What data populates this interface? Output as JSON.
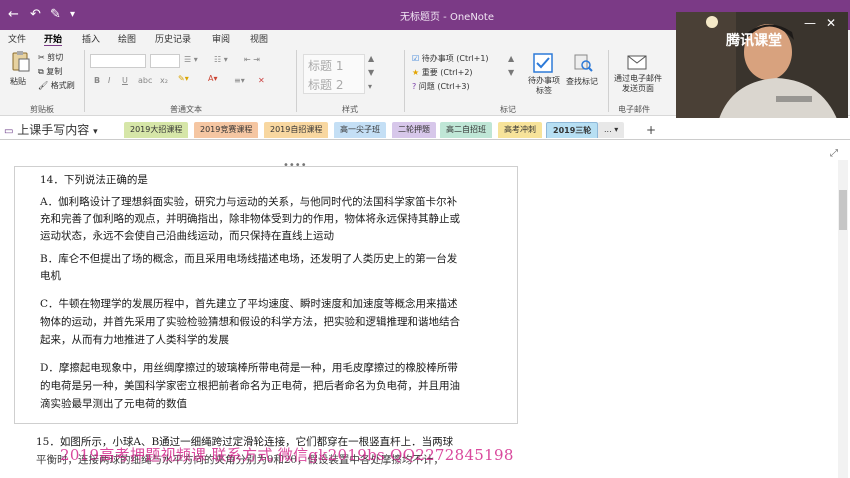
{
  "window": {
    "title": "无标题页 - OneNote"
  },
  "quick_access": {
    "back": "←",
    "undo": "↶",
    "touch": "✎",
    "more": "▾"
  },
  "ribbon_tabs": [
    "文件",
    "开始",
    "插入",
    "绘图",
    "历史记录",
    "审阅",
    "视图"
  ],
  "clipboard": {
    "paste": "粘贴",
    "cut": "剪切",
    "copy": "复制",
    "format": "格式刷",
    "label": "剪贴板"
  },
  "text_group": {
    "label": "普通文本",
    "bold": "B",
    "italic": "I",
    "underline": "U"
  },
  "styles": {
    "h1": "标题 1",
    "h2": "标题 2",
    "label": "样式"
  },
  "tags": {
    "todo": "待办事项 (Ctrl+1)",
    "important": "重要 (Ctrl+2)",
    "question": "问题 (Ctrl+3)",
    "todo_tag": "待办事项标签",
    "find_tags": "查找标记",
    "label": "标记"
  },
  "email": {
    "send": "通过电子邮件发送页面",
    "label": "电子邮件"
  },
  "webcam_brand": "腾讯课堂",
  "notebook": {
    "name": "上课手写内容"
  },
  "sections": [
    {
      "label": "2019大招课程",
      "color": "#d6e6a8"
    },
    {
      "label": "2019竞赛课程",
      "color": "#f5c6a2"
    },
    {
      "label": "2019自招课程",
      "color": "#f8d7a0"
    },
    {
      "label": "高一尖子班",
      "color": "#c4dff5"
    },
    {
      "label": "二轮押题",
      "color": "#d7c7ea"
    },
    {
      "label": "高二自招班",
      "color": "#bfe6d6"
    },
    {
      "label": "高考冲刺",
      "color": "#f7e39a"
    },
    {
      "label": "2019三轮",
      "color": "#b7dff3"
    }
  ],
  "sections_more": "...",
  "add_section": "+",
  "question14": {
    "title": "14．下列说法正确的是",
    "a1": "A．伽利略设计了理想斜面实验，研究力与运动的关系，与他同时代的法国科学家笛卡尔补",
    "a2": "充和完善了伽利略的观点，并明确指出，除非物体受到力的作用，物体将永远保持其静止或",
    "a3": "运动状态，永远不会使自己沿曲线运动，而只保持在直线上运动",
    "b1": "B．库仑不但提出了场的概念，而且采用电场线描述电场，还发明了人类历史上的第一台发",
    "b2": "电机",
    "c1": "C．牛顿在物理学的发展历程中，首先建立了平均速度、瞬时速度和加速度等概念用来描述",
    "c2": "物体的运动，并首先采用了实验检验猜想和假设的科学方法，把实验和逻辑推理和谐地结合",
    "c3": "起来，从而有力地推进了人类科学的发展",
    "d1": "D．摩擦起电现象中，用丝绸摩擦过的玻璃棒所带电荷是一种，用毛皮摩擦过的橡胶棒所带",
    "d2": "的电荷是另一种，美国科学家密立根把前者命名为正电荷，把后者命名为负电荷，并且用油",
    "d3": "滴实验最早测出了元电荷的数值"
  },
  "question15": {
    "l1": "15．如图所示，小球A、B通过一细绳跨过定滑轮连接，它们都穿在一根竖直杆上．当两球",
    "l2": "平衡时，连接两球的细绳与水平方向的夹角分别为θ和2θ，假设装置中各处摩擦均不计，"
  },
  "watermark": "2019高考押题视频课 联系方式 微信gk2019bs QQ2272845198"
}
